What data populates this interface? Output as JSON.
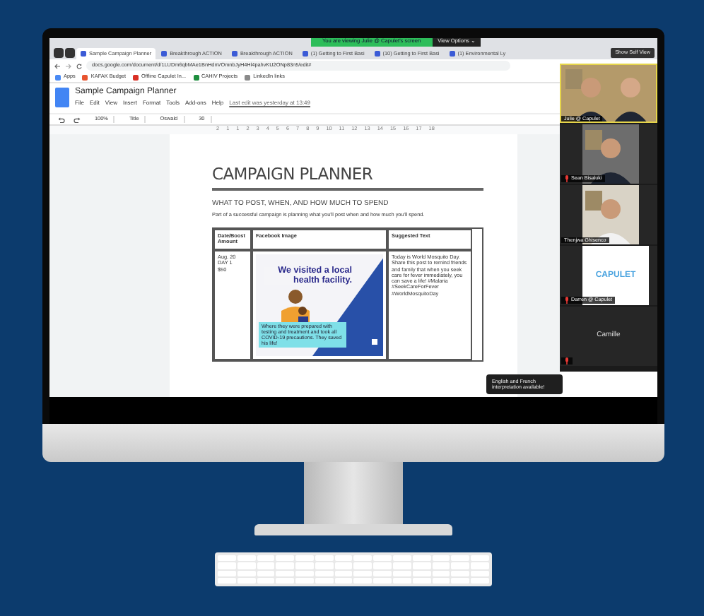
{
  "browser": {
    "tabs": [
      {
        "label": "Sample Campaign Planner",
        "selected": true
      },
      {
        "label": "Breakthrough ACTION",
        "selected": false
      },
      {
        "label": "Breakthrough ACTION",
        "selected": false
      },
      {
        "label": "(1) Getting to First Basi",
        "selected": false
      },
      {
        "label": "(10) Getting to First Basi",
        "selected": false
      },
      {
        "label": "(1) Environmental Ly",
        "selected": false
      }
    ],
    "banner": "You are viewing Julie @ Capulet's screen",
    "view_options": "View Options ⌄",
    "self_view": "Show Self View",
    "url": "docs.google.com/document/d/1LUDm6qbMAe1BnHdnVOmnbJyH4Hl4pahvKU2ONp83n5/edit#",
    "bookmarks": [
      "Apps",
      "KAFAK Budget",
      "Offline Capulet In...",
      "CAHIV Projects",
      "LinkedIn links"
    ]
  },
  "document": {
    "title": "Sample Campaign Planner",
    "menu": [
      "File",
      "Edit",
      "View",
      "Insert",
      "Format",
      "Tools",
      "Add-ons",
      "Help"
    ],
    "last_edit": "Last edit was yesterday at 13:49",
    "toolbar": {
      "zoom": "100%",
      "style": "Title",
      "font": "Oswald",
      "size": "30"
    },
    "ruler": [
      "2",
      "1",
      "1",
      "2",
      "3",
      "4",
      "5",
      "6",
      "7",
      "8",
      "9",
      "10",
      "11",
      "12",
      "13",
      "14",
      "15",
      "16",
      "17",
      "18"
    ],
    "heading": "CAMPAIGN PLANNER",
    "subheading": "WHAT TO POST, WHEN, AND HOW MUCH TO SPEND",
    "intro": "Part of a successful campaign is planning what you'll post when and how much you'll spend.",
    "table": {
      "columns": [
        "Date/Boost Amount",
        "Facebook Image",
        "Suggested Text"
      ],
      "rows": [
        {
          "date": [
            "Aug. 20",
            "DAY 1",
            "$50"
          ],
          "image": {
            "headline": "We visited a local health facility.",
            "caption": "Where they were prepared with testing and treatment and took all COVID-19 precautions. They saved his life!"
          },
          "text": "Today is World Mosquito Day. Share this post to remind friends and family that when you seek care for fever immediately, you can save a life! #Malaria #SeekCareForFever #WorldMosquitoDay"
        }
      ]
    }
  },
  "meeting": {
    "participants": [
      {
        "name": "Julie @ Capulet",
        "kind": "video",
        "muted": false,
        "active": true
      },
      {
        "name": "Sean Bisaluki",
        "kind": "video",
        "muted": true,
        "active": false
      },
      {
        "name": "Thenjwa Ghisenco",
        "kind": "video",
        "muted": false,
        "active": false
      },
      {
        "name": "Darren @ Capulet",
        "kind": "logo",
        "logo": "CAPULET",
        "muted": true,
        "active": false
      },
      {
        "name": "Camille",
        "kind": "name",
        "muted": true,
        "active": false
      }
    ],
    "notice": "English and French interpretation available!"
  }
}
